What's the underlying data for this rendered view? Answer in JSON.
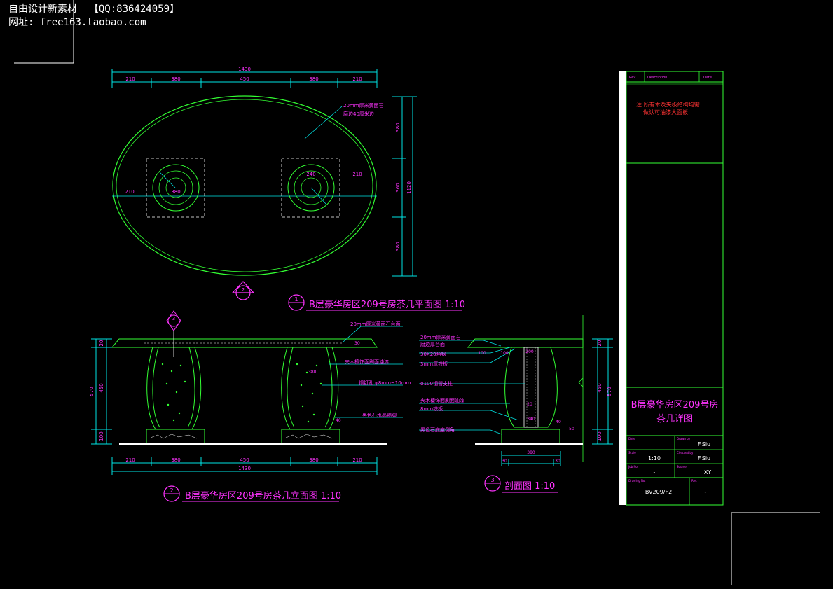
{
  "watermark": {
    "line1": "自由设计新素材  【QQ:836424059】",
    "line2": "网址: free163.taobao.com"
  },
  "plan": {
    "title": "B层豪华房区209号房茶几平面图 1:10",
    "symbol_num": "1",
    "ref_symbol_num": "2",
    "overall_width": "1430",
    "top_dims": [
      "210",
      "380",
      "450",
      "380",
      "210"
    ],
    "overall_height": "1120",
    "right_dims": [
      "380",
      "360",
      "380"
    ],
    "note": [
      "20mm厚米黄面石",
      "磨边40厘米边"
    ],
    "inner_dims": [
      "210",
      "380",
      "210",
      "240"
    ]
  },
  "elevation": {
    "title": "B层豪华房区209号房茶几立面图 1:10",
    "symbol_num": "2",
    "section_mark": "3",
    "overall_width": "1430",
    "bottom_dims": [
      "210",
      "380",
      "450",
      "380",
      "210"
    ],
    "left_dims": [
      "20",
      "450",
      "100"
    ],
    "overall_height": "570",
    "notes": [
      "20mm厚米黄面石台面",
      "夹木檀饰面刷面油漆",
      "铜钉孔 φ8mm~10mm",
      "黑色石水晶锡脚"
    ],
    "small_dims": [
      "30",
      "40",
      "380"
    ]
  },
  "section": {
    "title": "剖面图 1:10",
    "symbol_num": "3",
    "notes": [
      "20mm厚米黄面石",
      "磨边厚台面",
      "30X20角钢",
      "3mm厚铁板",
      "φ100钢管支柱",
      "夹木檀饰面刷面油漆",
      "8mm铁板",
      "黑色石底座倒角"
    ],
    "dims": [
      "100",
      "100",
      "200",
      "20",
      "40",
      "340",
      "50",
      "380",
      "30",
      "30"
    ],
    "right_dims": [
      "20",
      "450",
      "100"
    ],
    "overall_height": "570"
  },
  "title_block": {
    "header_cols": [
      "Rev.",
      "Description",
      "Date"
    ],
    "note_lines": [
      "注:所有木及夹板结构均需",
      "做认可油漆大面板"
    ],
    "project_title_line1": "B层豪华房区209号房",
    "project_title_line2": "茶几详图",
    "rows": [
      {
        "label1": "Date",
        "value1": "",
        "label2": "Drawn by",
        "value2": "F.Siu"
      },
      {
        "label1": "Scale",
        "value1": "1:10",
        "label2": "Checked by",
        "value2": "F.Siu"
      },
      {
        "label1": "Job No.",
        "value1": "-",
        "label2": "Source",
        "value2": "XY"
      }
    ],
    "drawing_no_label": "Drawing No.",
    "drawing_no": "BV209/F2",
    "rev_label": "Rev.",
    "rev_value": "-"
  }
}
